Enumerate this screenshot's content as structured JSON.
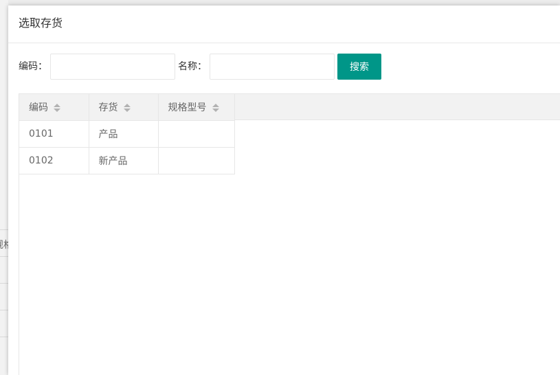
{
  "dialog": {
    "title": "选取存货"
  },
  "background": {
    "partial_text": "规格"
  },
  "search": {
    "code_label": "编码：",
    "code_value": "",
    "code_placeholder": "",
    "name_label": "名称：",
    "name_value": "",
    "name_placeholder": "",
    "button_label": "搜索"
  },
  "table": {
    "columns": [
      {
        "label": "编码",
        "sortable": true
      },
      {
        "label": "存货",
        "sortable": true
      },
      {
        "label": "规格型号",
        "sortable": true
      }
    ],
    "rows": [
      [
        "0101",
        "产品",
        ""
      ],
      [
        "0102",
        "新产品",
        ""
      ]
    ]
  },
  "colors": {
    "accent": "#009688",
    "header_bg": "#f2f2f2",
    "border": "#e6e6e6"
  },
  "icons": {
    "sort": "sort-caret-icon"
  }
}
